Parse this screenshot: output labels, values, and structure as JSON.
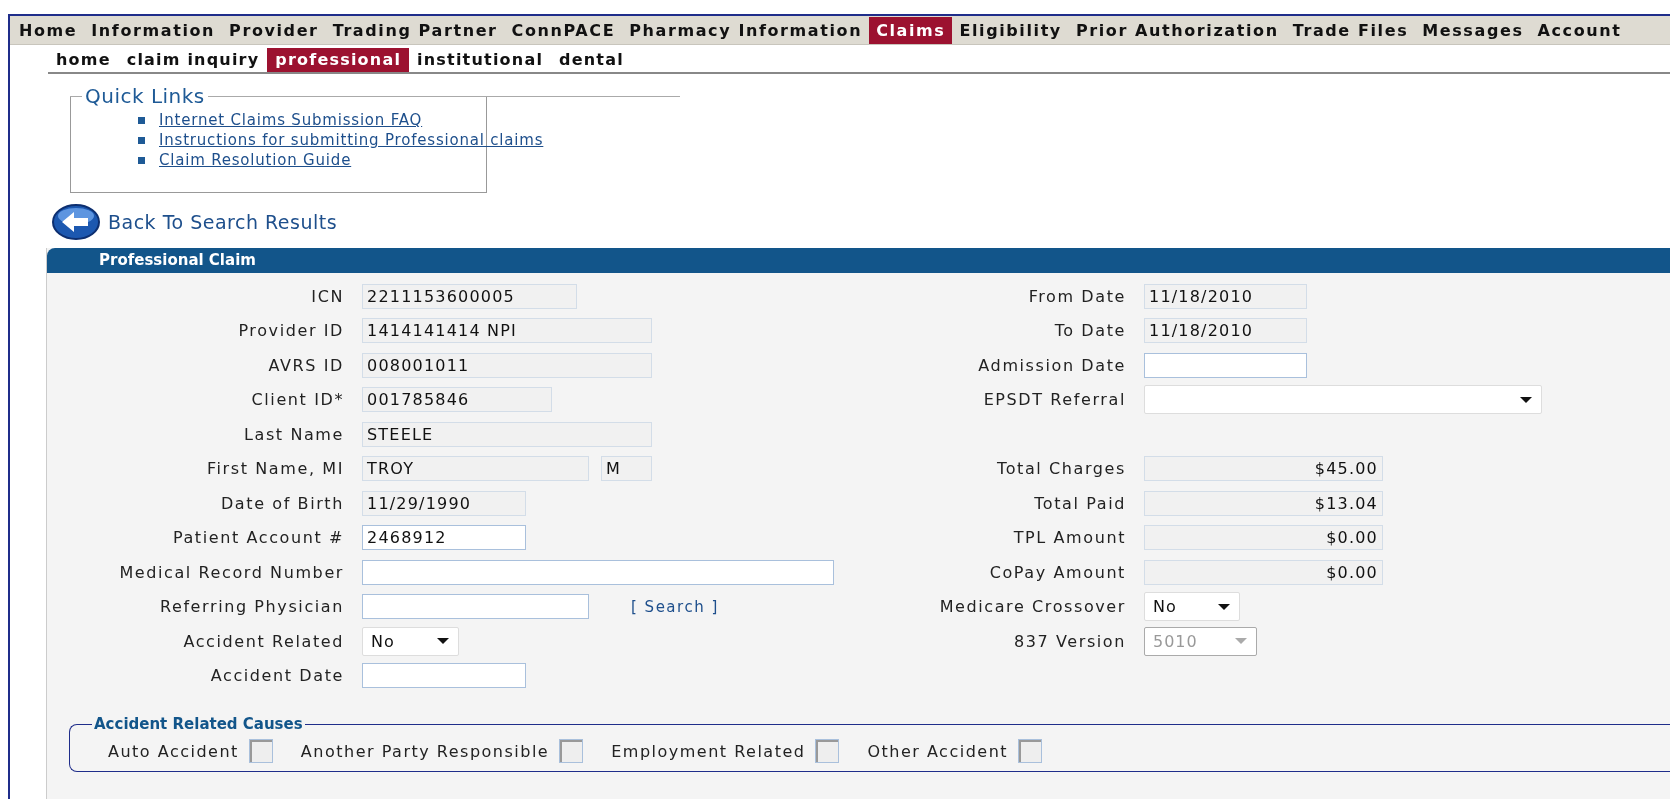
{
  "main_nav": [
    {
      "label": "Home",
      "selected": false
    },
    {
      "label": "Information",
      "selected": false
    },
    {
      "label": "Provider",
      "selected": false
    },
    {
      "label": "Trading Partner",
      "selected": false
    },
    {
      "label": "ConnPACE",
      "selected": false
    },
    {
      "label": "Pharmacy Information",
      "selected": false
    },
    {
      "label": "Claims",
      "selected": true
    },
    {
      "label": "Eligibility",
      "selected": false
    },
    {
      "label": "Prior Authorization",
      "selected": false
    },
    {
      "label": "Trade Files",
      "selected": false
    },
    {
      "label": "Messages",
      "selected": false
    },
    {
      "label": "Account",
      "selected": false
    }
  ],
  "sub_nav": [
    {
      "label": "home",
      "selected": false
    },
    {
      "label": "claim inquiry",
      "selected": false
    },
    {
      "label": "professional",
      "selected": true
    },
    {
      "label": "institutional",
      "selected": false
    },
    {
      "label": "dental",
      "selected": false
    }
  ],
  "quick_links": {
    "title": "Quick Links",
    "links": [
      "Internet Claims Submission FAQ",
      "Instructions for submitting Professional claims",
      "Claim Resolution Guide"
    ]
  },
  "back_link": "Back To Search Results",
  "panel_title": "Professional Claim",
  "rows": [
    {
      "left": {
        "label": "ICN",
        "fields": [
          {
            "kind": "readonly",
            "value": "2211153600005"
          }
        ]
      },
      "right": {
        "label": "From Date",
        "fields": [
          {
            "kind": "readonly",
            "value": "11/18/2010"
          }
        ]
      }
    },
    {
      "left": {
        "label": "Provider ID",
        "fields": [
          {
            "kind": "readonly",
            "value": "1414141414 NPI"
          }
        ]
      },
      "right": {
        "label": "To Date",
        "fields": [
          {
            "kind": "readonly",
            "value": "11/18/2010"
          }
        ]
      }
    },
    {
      "left": {
        "label": "AVRS ID",
        "fields": [
          {
            "kind": "readonly",
            "value": "008001011"
          }
        ]
      },
      "right": {
        "label": "Admission Date",
        "fields": [
          {
            "kind": "input"
          }
        ]
      }
    },
    {
      "left": {
        "label": "Client ID*",
        "fields": [
          {
            "kind": "readonly",
            "value": "001785846"
          }
        ]
      },
      "right": {
        "label": "EPSDT Referral",
        "fields": [
          {
            "kind": "select"
          }
        ]
      }
    },
    {
      "left": {
        "label": "Last Name",
        "fields": [
          {
            "kind": "readonly",
            "value": "STEELE"
          }
        ]
      }
    },
    {
      "left": {
        "label": "First Name, MI",
        "fields": [
          {
            "kind": "readonly",
            "value": "TROY"
          },
          {
            "kind": "readonly",
            "value": "M"
          }
        ]
      },
      "right": {
        "label": "Total Charges",
        "fields": [
          {
            "kind": "amount",
            "value": "$45.00"
          }
        ]
      }
    },
    {
      "left": {
        "label": "Date of Birth",
        "fields": [
          {
            "kind": "readonly",
            "value": "11/29/1990"
          }
        ]
      },
      "right": {
        "label": "Total Paid",
        "fields": [
          {
            "kind": "amount",
            "value": "$13.04"
          }
        ]
      }
    },
    {
      "left": {
        "label": "Patient Account #",
        "fields": [
          {
            "kind": "input",
            "value": "2468912"
          }
        ]
      },
      "right": {
        "label": "TPL Amount",
        "fields": [
          {
            "kind": "amount",
            "value": "$0.00"
          }
        ]
      }
    },
    {
      "left": {
        "label": "Medical Record Number",
        "fields": [
          {
            "kind": "input"
          }
        ]
      },
      "right": {
        "label": "CoPay Amount",
        "fields": [
          {
            "kind": "amount",
            "value": "$0.00"
          }
        ]
      }
    },
    {
      "left": {
        "label": "Referring Physician",
        "fields": [
          {
            "kind": "input"
          }
        ],
        "link": "[ Search ]"
      },
      "right": {
        "label": "Medicare Crossover",
        "fields": [
          {
            "kind": "select",
            "value": "No"
          }
        ]
      }
    },
    {
      "left": {
        "label": "Accident Related",
        "fields": [
          {
            "kind": "select",
            "value": "No"
          }
        ]
      },
      "right": {
        "label": "837 Version",
        "fields": [
          {
            "kind": "select",
            "value": "5010",
            "disabled": true
          }
        ]
      }
    },
    {
      "left": {
        "label": "Accident Date",
        "fields": [
          {
            "kind": "input"
          }
        ]
      }
    }
  ],
  "causes": {
    "title": "Accident Related Causes",
    "items": [
      {
        "label": "Auto Accident",
        "checked": false
      },
      {
        "label": "Another Party Responsible",
        "checked": false
      },
      {
        "label": "Employment Related",
        "checked": false
      },
      {
        "label": "Other Accident",
        "checked": false
      }
    ]
  }
}
